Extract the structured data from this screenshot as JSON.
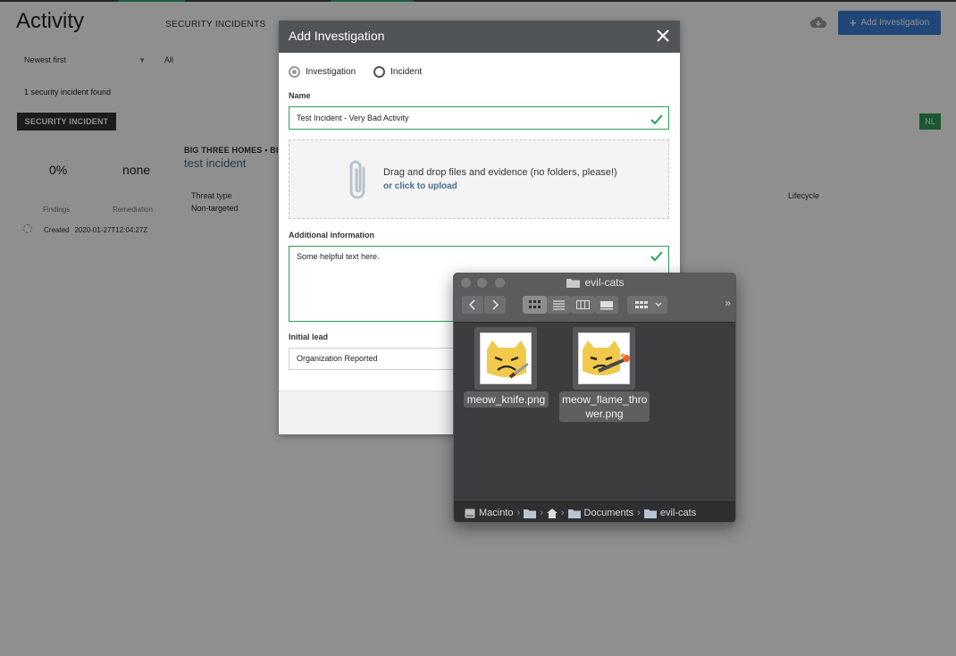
{
  "app": {
    "page_title": "Activity",
    "nav_tab": "SECURITY INCIDENTS",
    "add_button": "Add Investigation",
    "sort": "Newest first",
    "filter": "All",
    "found_text": "1 security incident found",
    "section_badge": "SECURITY INCIDENT",
    "right_badge": "NL",
    "org": "BIG THREE HOMES  •  BI",
    "incident_name": "test incident",
    "pct": "0%",
    "remediation_value": "none",
    "findings_label": "Findings",
    "remediation_label": "Remediation",
    "threat_label": "Threat type",
    "threat_value": "Non-targeted",
    "lifecycle_label": "Lifecycle",
    "created_label": "Created",
    "created_value": "2020-01-27T12:04:27Z"
  },
  "modal": {
    "title": "Add Investigation",
    "radio_investigation": "Investigation",
    "radio_incident": "Incident",
    "selected_type": "Investigation",
    "name_label": "Name",
    "name_value": "Test Incident - Very Bad Activity",
    "dropzone_text": "Drag and drop files and evidence (no folders, please!)",
    "dropzone_link": "or click to upload",
    "additional_label": "Additional information",
    "additional_value": "Some helpful text here.",
    "lead_label": "Initial lead",
    "lead_value": "Organization Reported"
  },
  "finder": {
    "title": "evil-cats",
    "files": [
      {
        "name": "meow_knife.png",
        "icon": "cat-knife-image"
      },
      {
        "name": "meow_flame_thro wer.png",
        "icon": "cat-flamethrower-image"
      }
    ],
    "path": [
      "Macinto",
      "Documents",
      "evil-cats"
    ]
  },
  "colors": {
    "accent_blue": "#3a7fd5",
    "success_green": "#2e9d58",
    "modal_header": "#515457",
    "finder_bg": "#3d3d3f"
  }
}
